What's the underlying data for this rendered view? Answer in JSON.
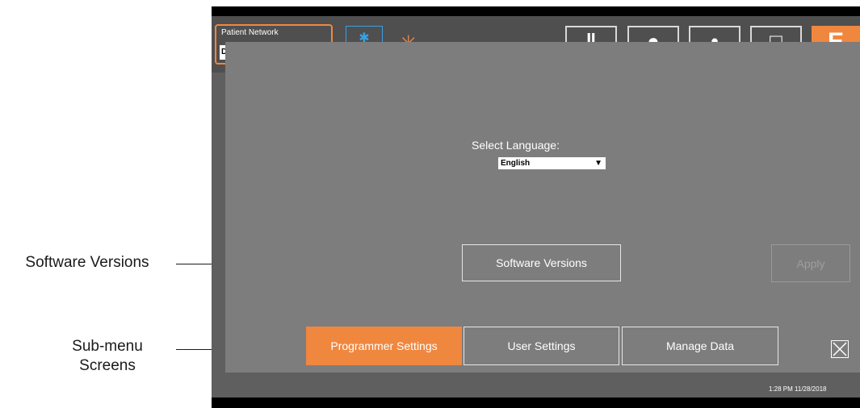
{
  "annotations": {
    "software_versions": "Software Versions",
    "submenu_line1": "Sub-menu",
    "submenu_line2": "Screens"
  },
  "topbar": {
    "patient_network_label": "Patient Network",
    "patient_network_value": "D"
  },
  "dialog": {
    "select_language_label": "Select Language:",
    "language_selected": "English",
    "software_versions_button": "Software Versions",
    "apply_button": "Apply",
    "tabs": [
      {
        "label": "Programmer Settings",
        "active": true
      },
      {
        "label": "User Settings",
        "active": false
      },
      {
        "label": "Manage Data",
        "active": false
      }
    ]
  },
  "status": {
    "timestamp": "1:28 PM 11/28/2018"
  },
  "colors": {
    "accent": "#f0873f",
    "dialog_bg": "#7d7d7d",
    "app_bg": "#5f5f5f",
    "bluetooth": "#3aa0e0"
  },
  "icons": [
    "bluetooth-icon",
    "logo-star-icon",
    "close-icon",
    "dropdown-arrow-icon"
  ]
}
